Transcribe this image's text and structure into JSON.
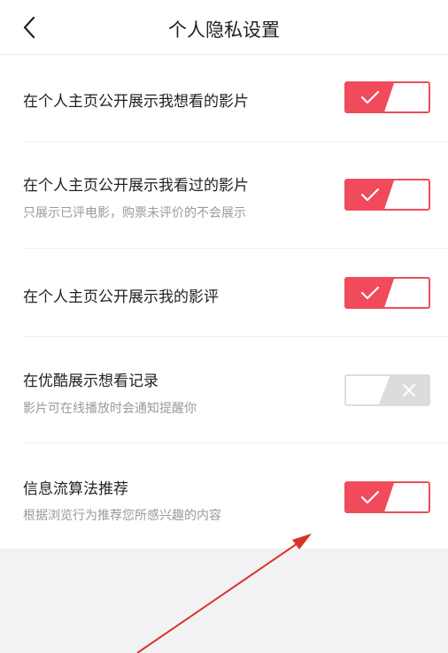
{
  "header": {
    "title": "个人隐私设置",
    "back_icon": "chevron-left-icon"
  },
  "settings": [
    {
      "title": "在个人主页公开展示我想看的影片",
      "subtitle": "",
      "enabled": true
    },
    {
      "title": "在个人主页公开展示我看过的影片",
      "subtitle": "只展示已评电影，购票未评价的不会展示",
      "enabled": true
    },
    {
      "title": "在个人主页公开展示我的影评",
      "subtitle": "",
      "enabled": true
    },
    {
      "title": "在优酷展示想看记录",
      "subtitle": "影片可在线播放时会通知提醒你",
      "enabled": false
    },
    {
      "title": "信息流算法推荐",
      "subtitle": "根据浏览行为推荐您所感兴趣的内容",
      "enabled": true
    }
  ],
  "colors": {
    "accent": "#f04a5b",
    "toggle_off": "#dcdcdc",
    "annotation_arrow": "#d9342b"
  }
}
